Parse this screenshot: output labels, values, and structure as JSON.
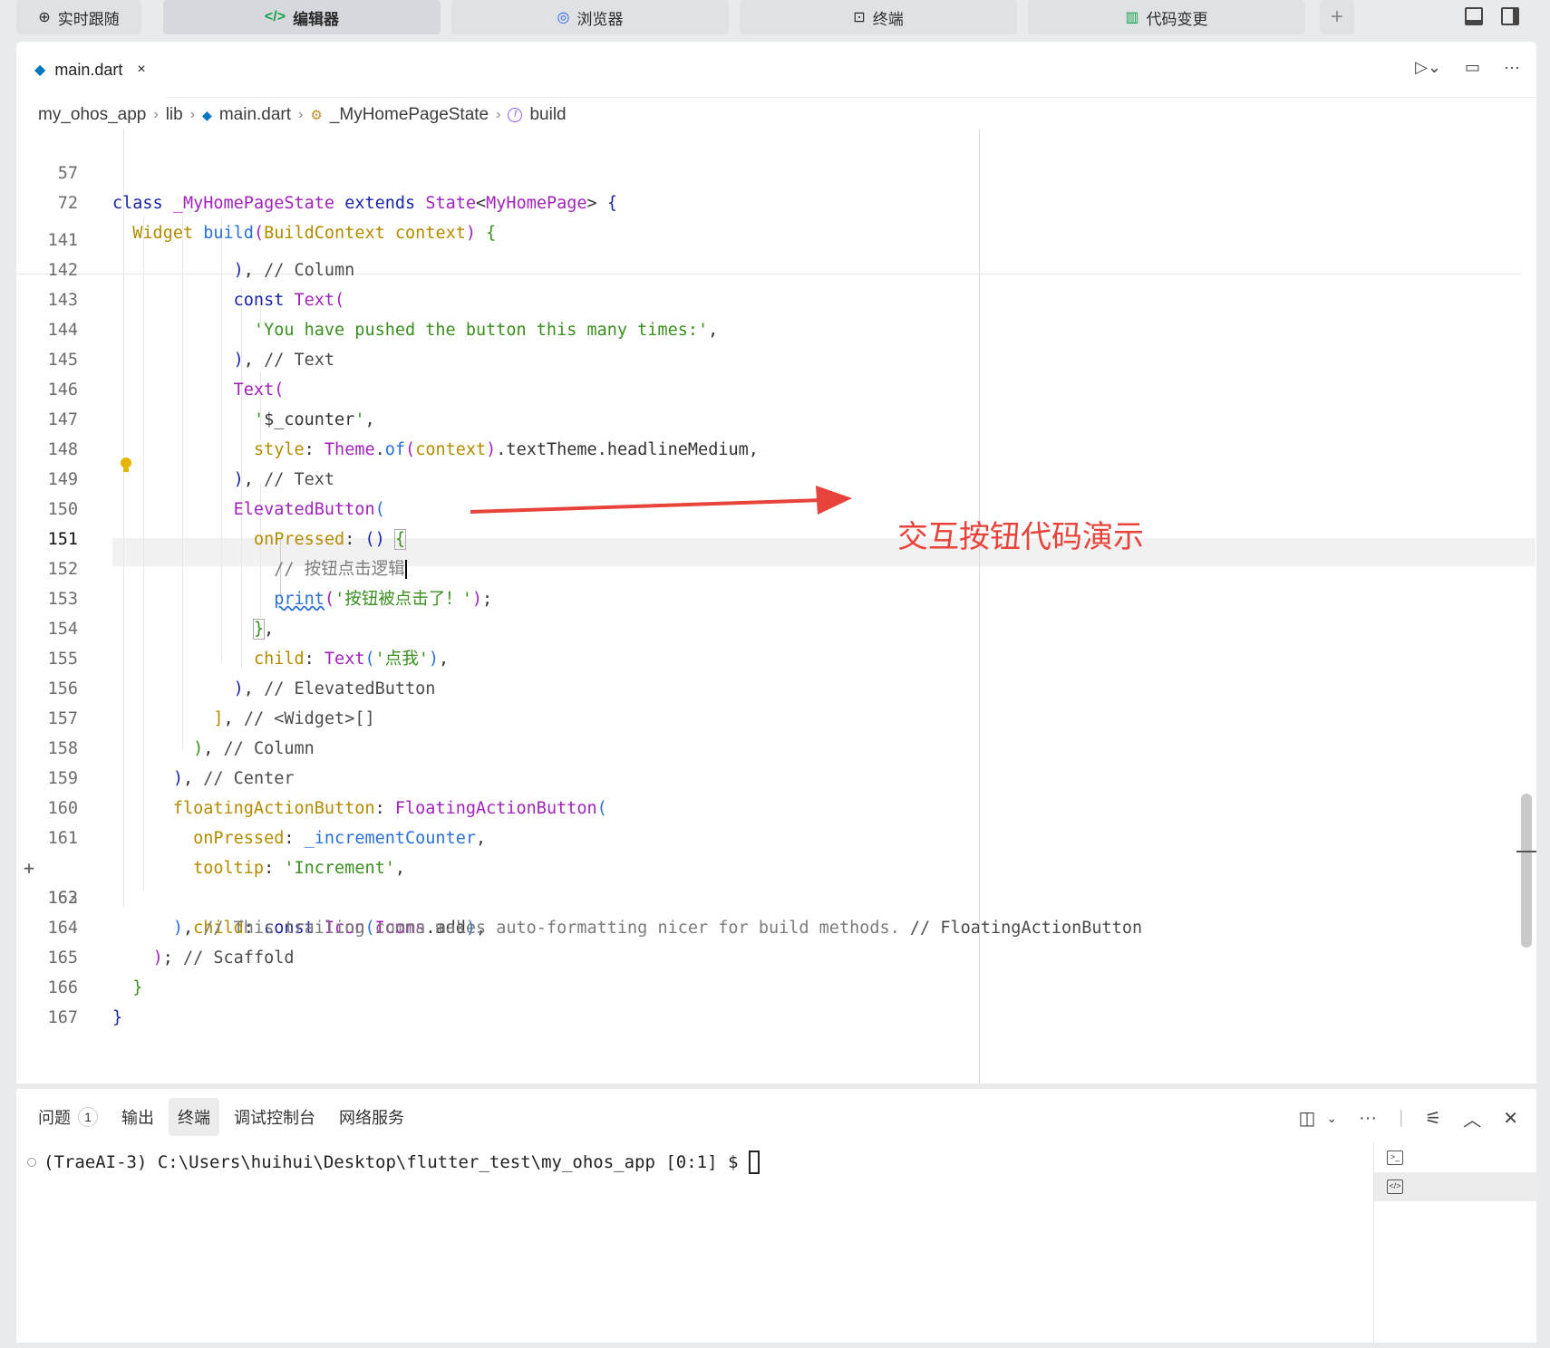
{
  "top_tabs": [
    {
      "label": "实时跟随",
      "icon": "crosshair-icon"
    },
    {
      "label": "编辑器",
      "icon": "code-icon",
      "active": true
    },
    {
      "label": "浏览器",
      "icon": "compass-icon"
    },
    {
      "label": "终端",
      "icon": "terminal-icon"
    },
    {
      "label": "代码变更",
      "icon": "diff-icon"
    }
  ],
  "file_tab": {
    "name": "main.dart",
    "close": "×"
  },
  "breadcrumb": [
    "my_ohos_app",
    "lib",
    "main.dart",
    "_MyHomePageState",
    "build"
  ],
  "code_lines": [
    {
      "num": "57",
      "text": "class _MyHomePageState extends State<MyHomePage> {"
    },
    {
      "num": "72",
      "text": "  Widget build(BuildContext context) {"
    },
    {
      "num": "141",
      "text": "            ), // Column"
    },
    {
      "num": "142",
      "text": "            const Text("
    },
    {
      "num": "143",
      "text": "              'You have pushed the button this many times:',"
    },
    {
      "num": "144",
      "text": "            ), // Text"
    },
    {
      "num": "145",
      "text": "            Text("
    },
    {
      "num": "146",
      "text": "              '$_counter',"
    },
    {
      "num": "147",
      "text": "              style: Theme.of(context).textTheme.headlineMedium,"
    },
    {
      "num": "148",
      "text": "            ), // Text"
    },
    {
      "num": "149",
      "text": "            ElevatedButton("
    },
    {
      "num": "150",
      "text": "              onPressed: () {"
    },
    {
      "num": "151",
      "text": "                // 按钮点击逻辑"
    },
    {
      "num": "152",
      "text": "                print('按钮被点击了！');"
    },
    {
      "num": "153",
      "text": "              },"
    },
    {
      "num": "154",
      "text": "              child: Text('点我'),"
    },
    {
      "num": "155",
      "text": "            ), // ElevatedButton"
    },
    {
      "num": "156",
      "text": "          ], // <Widget>[]"
    },
    {
      "num": "157",
      "text": "        ), // Column"
    },
    {
      "num": "158",
      "text": "      ), // Center"
    },
    {
      "num": "159",
      "text": "      floatingActionButton: FloatingActionButton("
    },
    {
      "num": "160",
      "text": "        onPressed: _incrementCounter,"
    },
    {
      "num": "161",
      "text": "        tooltip: 'Increment',"
    },
    {
      "num": "162",
      "text": "        child: const Icon(Icons.add),"
    },
    {
      "num": "163",
      "text": "      ), // This trailing comma makes auto-formatting nicer for build methods. // FloatingActionButton"
    },
    {
      "num": "164",
      "text": "    ); // Scaffold"
    },
    {
      "num": "165",
      "text": "  }"
    },
    {
      "num": "166",
      "text": "}"
    },
    {
      "num": "167",
      "text": ""
    }
  ],
  "annotation": "交互按钮代码演示",
  "bottom_tabs": [
    {
      "label": "问题",
      "badge": "1"
    },
    {
      "label": "输出"
    },
    {
      "label": "终端",
      "active": true
    },
    {
      "label": "调试控制台"
    },
    {
      "label": "网络服务"
    }
  ],
  "terminal": {
    "prompt": "(TraeAI-3) C:\\Users\\huihui\\Desktop\\flutter_test\\my_ohos_app [0:1] $"
  },
  "colors": {
    "accent": "#e8433a",
    "keyword": "#1a24a5",
    "type": "#a023ba",
    "string": "#3a8f1f",
    "param": "#b28b00"
  }
}
